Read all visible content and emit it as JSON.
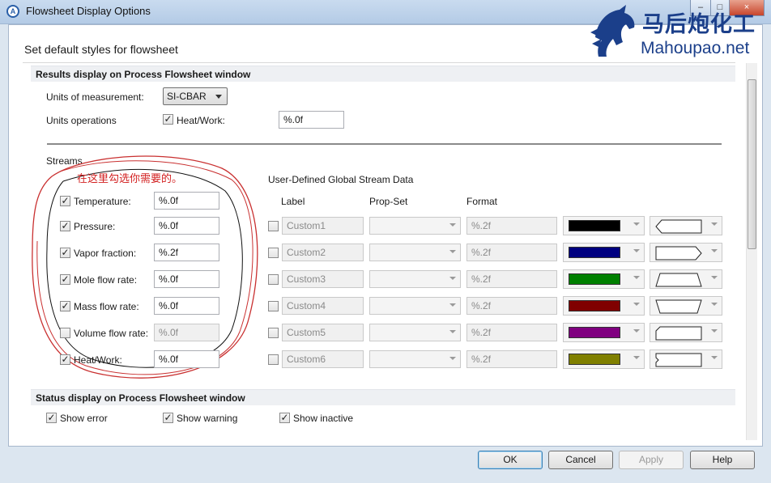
{
  "window": {
    "title": "Flowsheet Display Options",
    "app_icon": "A",
    "minimize": "–",
    "maximize": "□",
    "close": "×"
  },
  "watermark": {
    "cn": "马后炮化工",
    "en": "Mahoupao.net"
  },
  "heading": "Set default styles for flowsheet",
  "results_section": {
    "title": "Results display on Process Flowsheet window",
    "units_label": "Units of measurement:",
    "units_value": "SI-CBAR",
    "unitops_label": "Units operations",
    "heatwork_label": "Heat/Work:",
    "heatwork_checked": true,
    "heatwork_format": "%.0f"
  },
  "streams": {
    "title": "Streams",
    "annotation": "在这里勾选你需要的。",
    "items": [
      {
        "label": "Temperature:",
        "checked": true,
        "format": "%.0f",
        "enabled": true
      },
      {
        "label": "Pressure:",
        "checked": true,
        "format": "%.0f",
        "enabled": true
      },
      {
        "label": "Vapor fraction:",
        "checked": true,
        "format": "%.2f",
        "enabled": true
      },
      {
        "label": "Mole flow rate:",
        "checked": true,
        "format": "%.0f",
        "enabled": true
      },
      {
        "label": "Mass flow rate:",
        "checked": true,
        "format": "%.0f",
        "enabled": true
      },
      {
        "label": "Volume flow rate:",
        "checked": false,
        "format": "%.0f",
        "enabled": false
      },
      {
        "label": "Heat/Work:",
        "checked": true,
        "format": "%.0f",
        "enabled": true
      }
    ]
  },
  "user_defined": {
    "title": "User-Defined Global Stream Data",
    "col_label": "Label",
    "col_propset": "Prop-Set",
    "col_format": "Format",
    "rows": [
      {
        "label": "Custom1",
        "format": "%.2f",
        "color": "#000000",
        "shape": "hexagon-left"
      },
      {
        "label": "Custom2",
        "format": "%.2f",
        "color": "#000080",
        "shape": "arrow-right"
      },
      {
        "label": "Custom3",
        "format": "%.2f",
        "color": "#008000",
        "shape": "trapezoid"
      },
      {
        "label": "Custom4",
        "format": "%.2f",
        "color": "#800000",
        "shape": "trapezoid-inverted"
      },
      {
        "label": "Custom5",
        "format": "%.2f",
        "color": "#800080",
        "shape": "notch-left"
      },
      {
        "label": "Custom6",
        "format": "%.2f",
        "color": "#808000",
        "shape": "rectangle-notch"
      }
    ]
  },
  "status_section": {
    "title": "Status display on Process Flowsheet window",
    "items": [
      {
        "label": "Show error",
        "checked": true
      },
      {
        "label": "Show warning",
        "checked": true
      },
      {
        "label": "Show inactive",
        "checked": true
      }
    ]
  },
  "buttons": {
    "ok": "OK",
    "cancel": "Cancel",
    "apply": "Apply",
    "help": "Help"
  }
}
